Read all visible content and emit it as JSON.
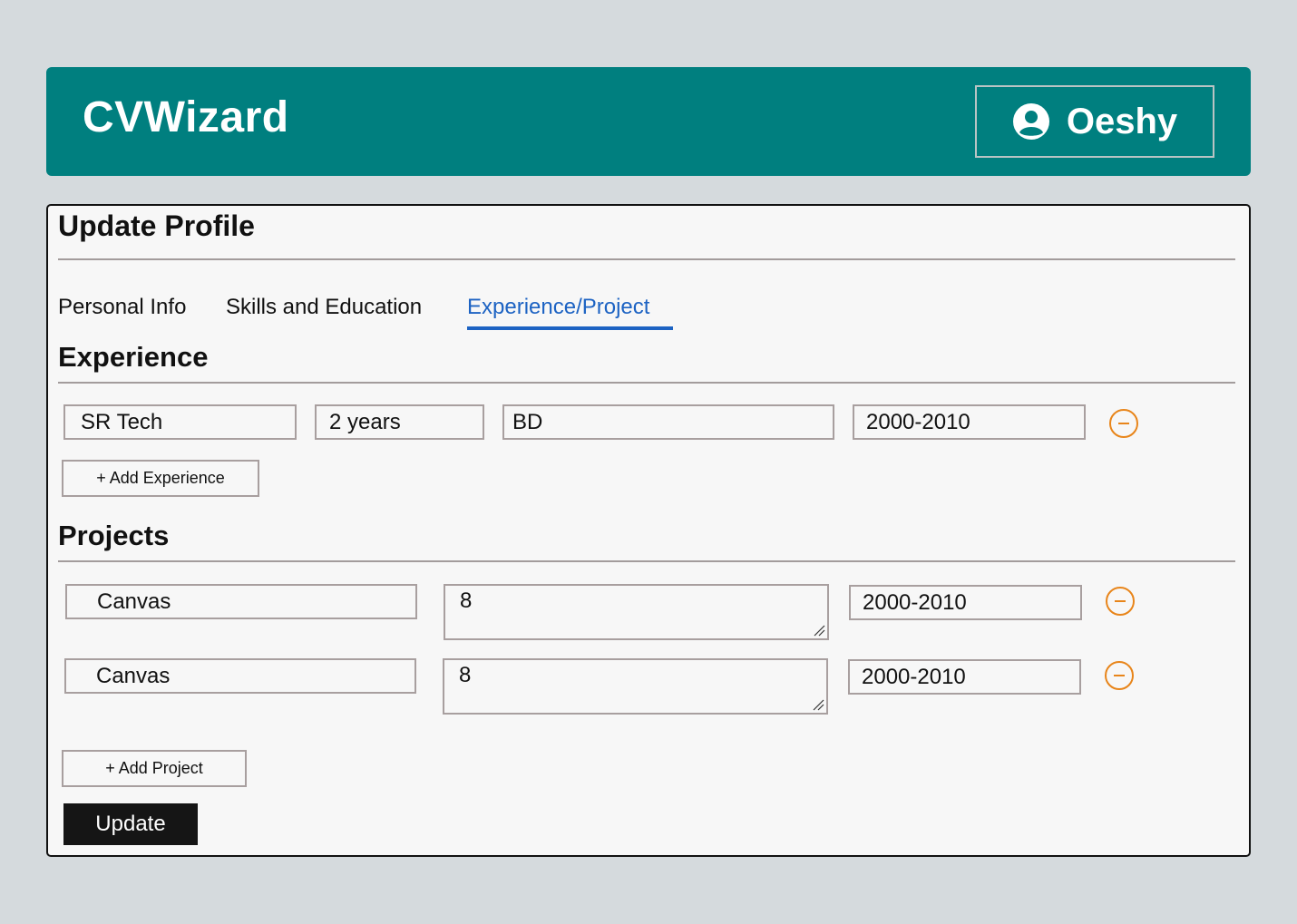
{
  "app": {
    "brand": "CVWizard",
    "user_name": "Oeshy"
  },
  "card": {
    "title": "Update Profile"
  },
  "tabs": [
    {
      "label": "Personal Info",
      "active": false
    },
    {
      "label": "Skills and Education",
      "active": false
    },
    {
      "label": "Experience/Project",
      "active": true
    }
  ],
  "experience": {
    "title": "Experience",
    "rows": [
      {
        "company": "SR Tech",
        "duration": "2 years",
        "location": "BD",
        "years": "2000-2010"
      }
    ],
    "add_label": "+ Add Experience"
  },
  "projects": {
    "title": "Projects",
    "rows": [
      {
        "name": "Canvas",
        "description": "8",
        "years": "2000-2010"
      },
      {
        "name": "Canvas",
        "description": "8",
        "years": "2000-2010"
      }
    ],
    "add_label": "+ Add Project"
  },
  "actions": {
    "update_label": "Update"
  },
  "colors": {
    "header": "#007f7f",
    "accent_tab": "#1d63c3",
    "remove_icon": "#e8851a",
    "page_bg": "#d5dadd"
  },
  "icons": {
    "user": "user-circle-icon",
    "remove": "minus-circle-icon",
    "resize": "resize-grip-icon"
  }
}
